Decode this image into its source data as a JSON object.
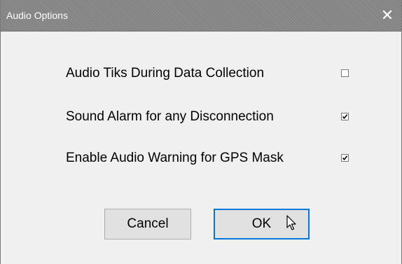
{
  "window": {
    "title": "Audio Options",
    "close_glyph": "✕"
  },
  "options": [
    {
      "label": "Audio Tiks During Data Collection",
      "checked": false
    },
    {
      "label": "Sound Alarm for any Disconnection",
      "checked": true
    },
    {
      "label": "Enable Audio Warning for GPS Mask",
      "checked": true
    }
  ],
  "buttons": {
    "cancel_label": "Cancel",
    "ok_label": "OK"
  },
  "colors": {
    "titlebar": "#8c8c8c",
    "dialog_bg": "#f0f0f0",
    "button_bg": "#e1e1e1",
    "focus_border": "#0078d7"
  },
  "icons": {
    "close": "close-icon",
    "check": "checkmark-icon",
    "cursor": "mouse-pointer-icon"
  }
}
